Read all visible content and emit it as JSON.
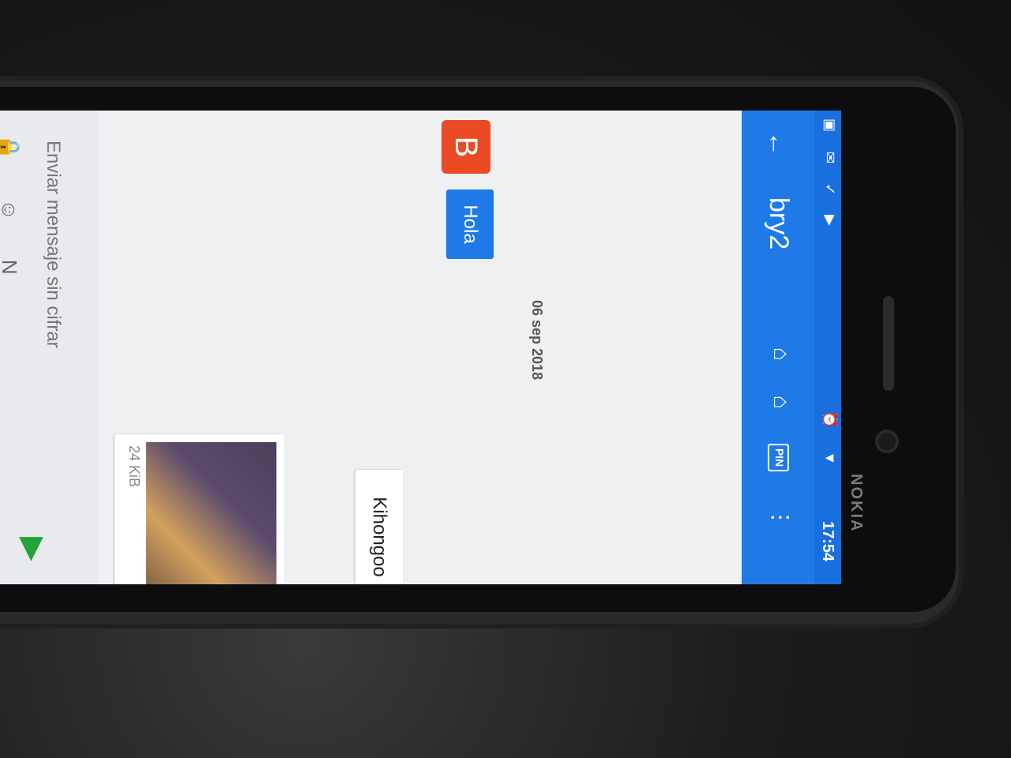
{
  "status": {
    "time": "17:54"
  },
  "header": {
    "title": "bry2"
  },
  "conversation": {
    "date": "06 sep 2018",
    "avatar_letter": "B",
    "messages": [
      {
        "text": "Hola"
      },
      {
        "text": "Kihongoo"
      }
    ],
    "image_size": "24 KiB"
  },
  "composer": {
    "placeholder": "Enviar mensaje sin cifrar"
  },
  "device_brand": "NOKIA"
}
